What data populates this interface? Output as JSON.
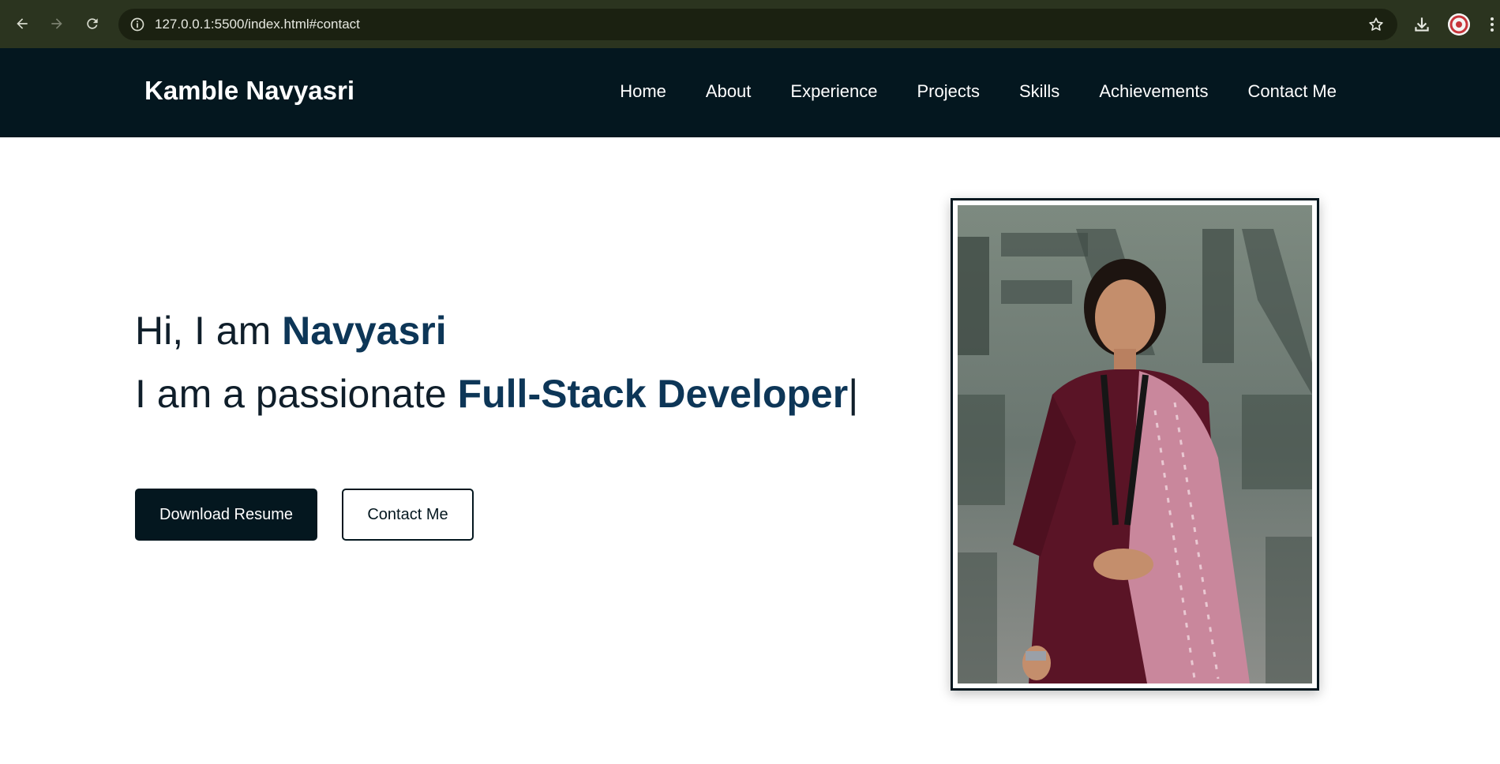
{
  "browser": {
    "url": "127.0.0.1:5500/index.html#contact"
  },
  "header": {
    "logo": "Kamble Navyasri",
    "nav": [
      {
        "label": "Home"
      },
      {
        "label": "About"
      },
      {
        "label": "Experience"
      },
      {
        "label": "Projects"
      },
      {
        "label": "Skills"
      },
      {
        "label": "Achievements"
      },
      {
        "label": "Contact Me"
      }
    ]
  },
  "hero": {
    "line1_prefix": "Hi, I am ",
    "line1_name": "Navyasri",
    "line2_prefix": "I am a passionate ",
    "line2_role": "Full-Stack Developer",
    "cursor": "|",
    "primary_button": "Download Resume",
    "secondary_button": "Contact Me"
  },
  "colors": {
    "header_bg": "#04171f",
    "accent": "#0d3657",
    "browser_bar": "#2b341f"
  },
  "icons": {
    "back": "arrow-left-icon",
    "forward": "arrow-right-icon",
    "reload": "reload-icon",
    "site_info": "info-icon",
    "bookmark": "star-icon",
    "downloads": "download-icon",
    "profile": "avatar",
    "menu": "kebab-menu-icon"
  }
}
